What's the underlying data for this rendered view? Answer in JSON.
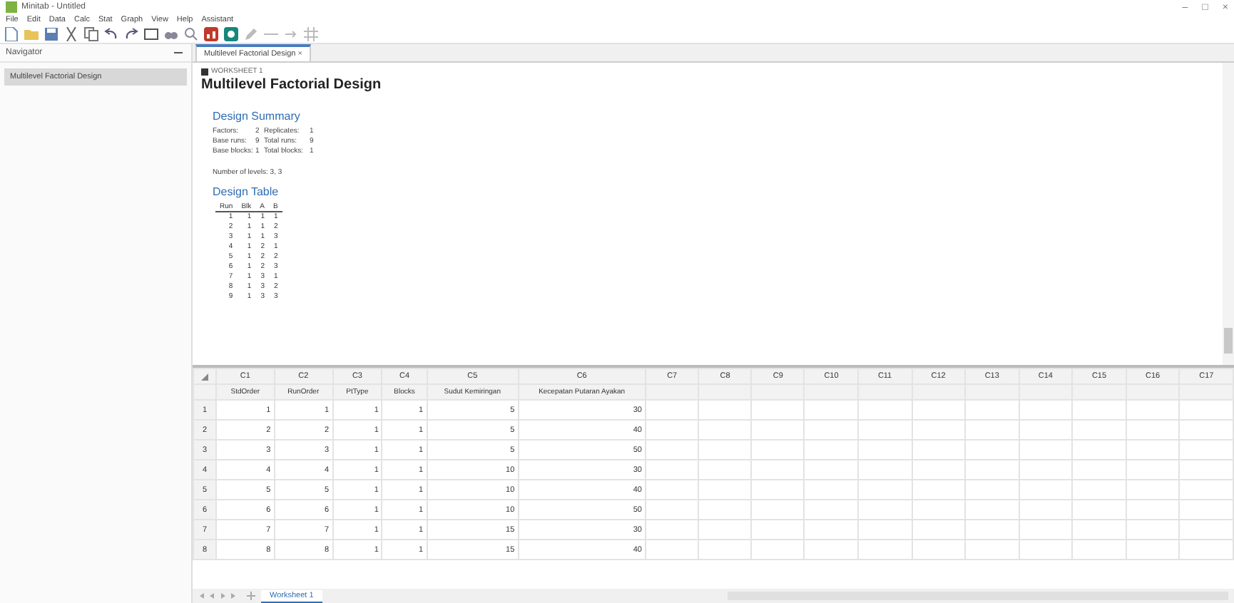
{
  "window": {
    "title": "Minitab - Untitled",
    "controls": [
      "–",
      "□",
      "×"
    ]
  },
  "menu": [
    "File",
    "Edit",
    "Data",
    "Calc",
    "Stat",
    "Graph",
    "View",
    "Help",
    "Assistant"
  ],
  "navigator": {
    "title": "Navigator",
    "items": [
      {
        "label": "Multilevel Factorial Design",
        "selected": true
      }
    ]
  },
  "output_tabs": [
    {
      "label": "Multilevel Factorial Design",
      "close": "×",
      "selected": true
    }
  ],
  "output": {
    "worksheet_label": "WORKSHEET 1",
    "title": "Multilevel Factorial Design",
    "summary_heading": "Design Summary",
    "summary_rows": [
      [
        "Factors:",
        "2",
        "Replicates:",
        "1"
      ],
      [
        "Base runs:",
        "9",
        "Total runs:",
        "9"
      ],
      [
        "Base blocks:",
        "1",
        "Total blocks:",
        "1"
      ]
    ],
    "levels_text": "Number of levels: 3, 3",
    "table_heading": "Design Table",
    "table_columns": [
      "Run",
      "Blk",
      "A",
      "B"
    ],
    "table_rows": [
      [
        "1",
        "1",
        "1",
        "1"
      ],
      [
        "2",
        "1",
        "1",
        "2"
      ],
      [
        "3",
        "1",
        "1",
        "3"
      ],
      [
        "4",
        "1",
        "2",
        "1"
      ],
      [
        "5",
        "1",
        "2",
        "2"
      ],
      [
        "6",
        "1",
        "2",
        "3"
      ],
      [
        "7",
        "1",
        "3",
        "1"
      ],
      [
        "8",
        "1",
        "3",
        "2"
      ],
      [
        "9",
        "1",
        "3",
        "3"
      ]
    ]
  },
  "worksheet": {
    "columns": [
      {
        "id": "C1",
        "name": "StdOrder"
      },
      {
        "id": "C2",
        "name": "RunOrder"
      },
      {
        "id": "C3",
        "name": "PtType"
      },
      {
        "id": "C4",
        "name": "Blocks"
      },
      {
        "id": "C5",
        "name": "Sudut Kemiringan"
      },
      {
        "id": "C6",
        "name": "Kecepatan Putaran Ayakan"
      },
      {
        "id": "C7"
      },
      {
        "id": "C8"
      },
      {
        "id": "C9"
      },
      {
        "id": "C10"
      },
      {
        "id": "C11"
      },
      {
        "id": "C12"
      },
      {
        "id": "C13"
      },
      {
        "id": "C14"
      },
      {
        "id": "C15"
      },
      {
        "id": "C16"
      },
      {
        "id": "C17"
      }
    ],
    "rows": [
      {
        "number": "1",
        "cells": [
          "1",
          "1",
          "1",
          "1",
          "5",
          "30"
        ]
      },
      {
        "number": "2",
        "cells": [
          "2",
          "2",
          "1",
          "1",
          "5",
          "40"
        ]
      },
      {
        "number": "3",
        "cells": [
          "3",
          "3",
          "1",
          "1",
          "5",
          "50"
        ]
      },
      {
        "number": "4",
        "cells": [
          "4",
          "4",
          "1",
          "1",
          "10",
          "30"
        ]
      },
      {
        "number": "5",
        "cells": [
          "5",
          "5",
          "1",
          "1",
          "10",
          "40"
        ]
      },
      {
        "number": "6",
        "cells": [
          "6",
          "6",
          "1",
          "1",
          "10",
          "50"
        ]
      },
      {
        "number": "7",
        "cells": [
          "7",
          "7",
          "1",
          "1",
          "15",
          "30"
        ]
      },
      {
        "number": "8",
        "cells": [
          "8",
          "8",
          "1",
          "1",
          "15",
          "40"
        ]
      }
    ]
  },
  "sheet_tabs": [
    {
      "label": "Worksheet 1",
      "selected": true
    }
  ]
}
